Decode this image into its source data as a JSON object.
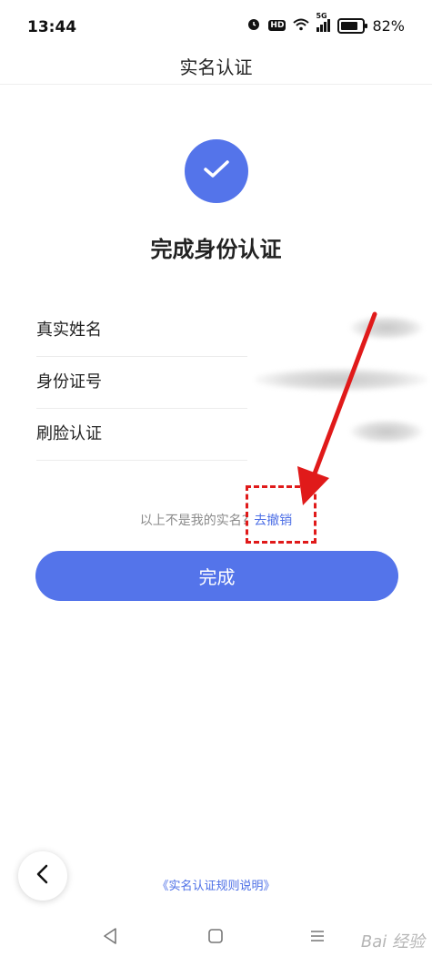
{
  "status_bar": {
    "time": "13:44",
    "hd_label": "HD",
    "network_label": "5G",
    "battery_percent_text": "82%",
    "battery_level": 0.82,
    "icons": [
      "alarm-icon",
      "hd-icon",
      "wifi-icon",
      "signal-icon",
      "battery-icon"
    ]
  },
  "header": {
    "title": "实名认证"
  },
  "result": {
    "title": "完成身份认证",
    "icon": "check-icon"
  },
  "info": {
    "rows": [
      {
        "label": "真实姓名"
      },
      {
        "label": "身份证号"
      },
      {
        "label": "刷脸认证"
      }
    ]
  },
  "revoke": {
    "prefix": "以上不是我的实名?",
    "link": "去撤销"
  },
  "actions": {
    "done_label": "完成"
  },
  "footer": {
    "rules_link": "《实名认证规则说明》"
  },
  "watermark": {
    "text": "Bai 经验"
  },
  "colors": {
    "accent": "#5474ea",
    "link": "#4d6fe6",
    "annotation": "#e01a1a"
  }
}
